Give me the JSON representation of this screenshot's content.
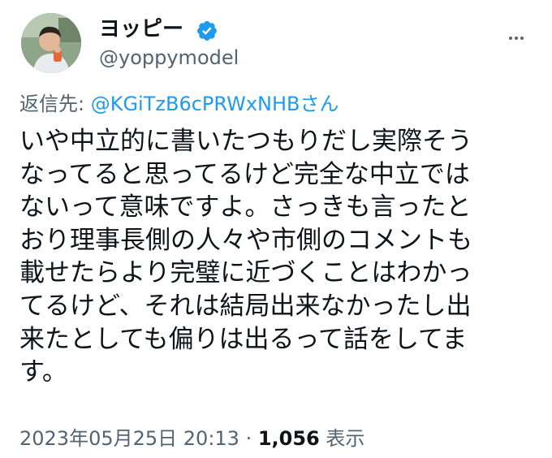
{
  "author": {
    "display_name": "ヨッピー",
    "handle": "@yoppymodel",
    "verified": true,
    "accent": "#1d9bf0"
  },
  "icons": {
    "verified": "verified-badge-icon",
    "more": "more-options-icon"
  },
  "reply": {
    "prefix": "返信先: ",
    "mention": "@KGiTzB6cPRWxNHBさん"
  },
  "body_lines": [
    "いや中立的に書いたつもりだし実際そう",
    "なってると思ってるけど完全な中立では",
    "ないって意味ですよ。さっきも言ったと",
    "おり理事長側の人々や市側のコメントも",
    "載せたらより完璧に近づくことはわかっ",
    "てるけど、それは結局出来なかったし出",
    "来たとしても偏りは出るって話をしてま",
    "す。"
  ],
  "meta": {
    "timestamp": "2023年05月25日 20:13",
    "separator": " · ",
    "views_count": "1,056",
    "views_label": " 表示"
  }
}
